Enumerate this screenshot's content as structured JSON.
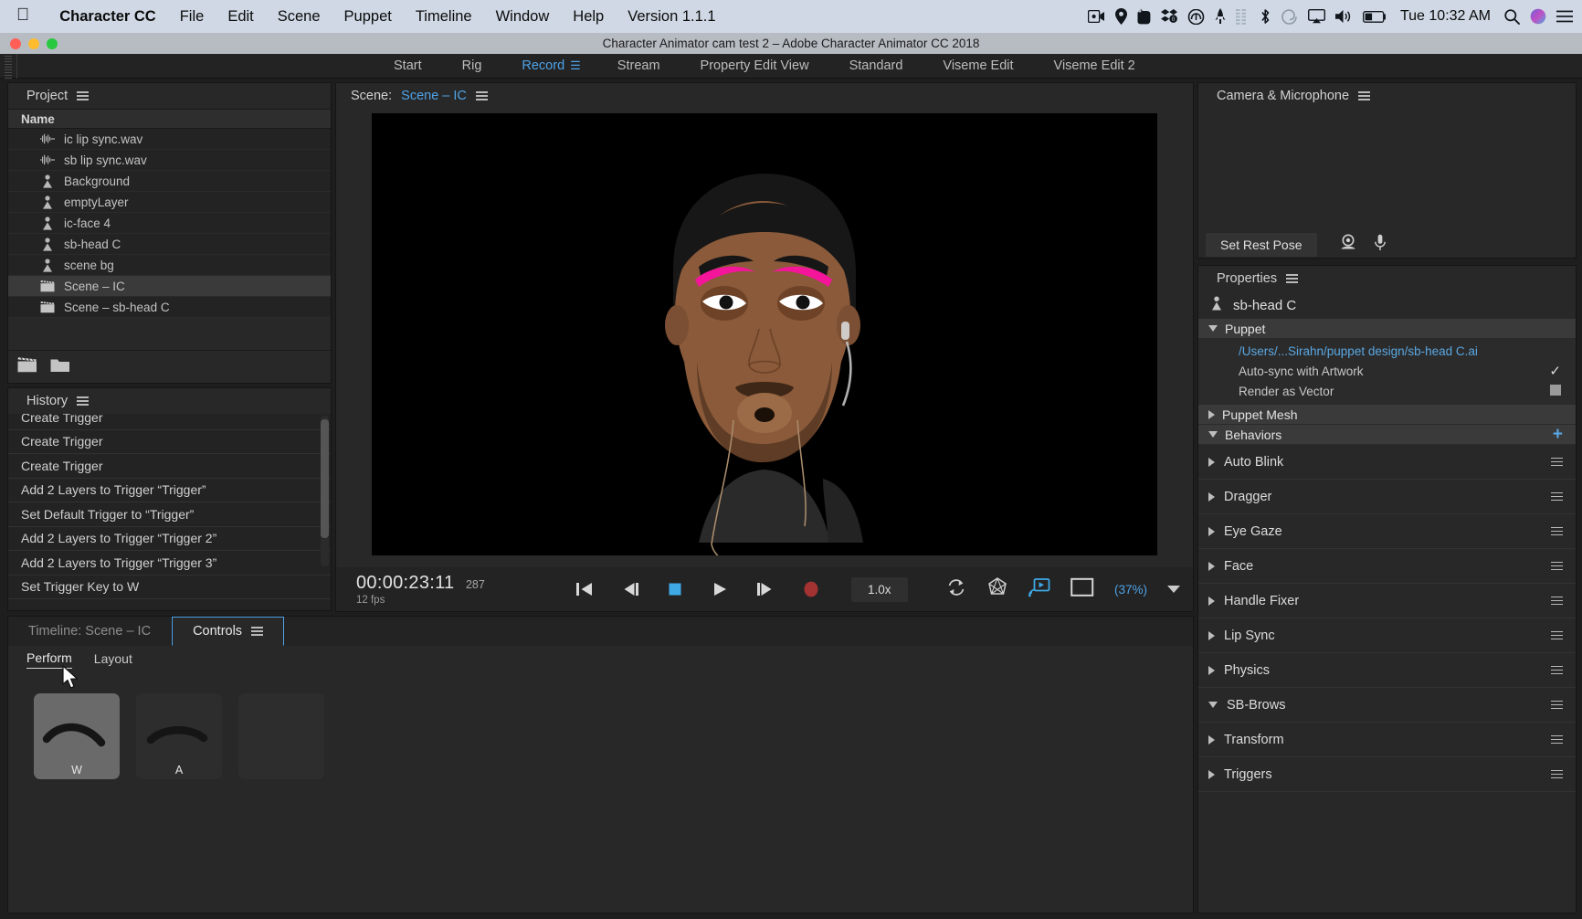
{
  "macbar": {
    "apple": "apple-logo",
    "items": [
      {
        "label": "Character CC",
        "bold": true
      },
      {
        "label": "File",
        "bold": false
      },
      {
        "label": "Edit",
        "bold": false
      },
      {
        "label": "Scene",
        "bold": false
      },
      {
        "label": "Puppet",
        "bold": false
      },
      {
        "label": "Timeline",
        "bold": false
      },
      {
        "label": "Window",
        "bold": false
      },
      {
        "label": "Help",
        "bold": false
      },
      {
        "label": "Version 1.1.1",
        "bold": false
      }
    ],
    "status_icons": [
      "screen-record-icon",
      "location-icon",
      "evernote-icon",
      "dropbox-icon",
      "creative-cloud-icon",
      "rocket-icon",
      "equalizer-icon",
      "bluetooth-icon",
      "spiral-icon",
      "airplay-icon",
      "volume-icon",
      "battery-icon"
    ],
    "clock": "Tue 10:32 AM",
    "search": "search-icon",
    "siri": "siri-icon",
    "notifications": "notification-center-icon"
  },
  "titlebar": {
    "title": "Character Animator cam test 2 – Adobe Character Animator CC 2018"
  },
  "workspaces": {
    "items": [
      {
        "label": "Start",
        "active": false
      },
      {
        "label": "Rig",
        "active": false
      },
      {
        "label": "Record",
        "active": true
      },
      {
        "label": "Stream",
        "active": false
      },
      {
        "label": "Property Edit View",
        "active": false
      },
      {
        "label": "Standard",
        "active": false
      },
      {
        "label": "Viseme Edit",
        "active": false
      },
      {
        "label": "Viseme Edit 2",
        "active": false
      }
    ],
    "menu_icon": "workspace-menu-icon"
  },
  "project": {
    "title": "Project",
    "menu_icon": "panel-menu-icon",
    "column_header": "Name",
    "items": [
      {
        "name": "ic lip sync.wav",
        "icon": "audio-waveform-icon",
        "selected": false
      },
      {
        "name": "sb lip sync.wav",
        "icon": "audio-waveform-icon",
        "selected": false
      },
      {
        "name": "Background",
        "icon": "puppet-icon",
        "selected": false
      },
      {
        "name": "emptyLayer",
        "icon": "puppet-icon",
        "selected": false
      },
      {
        "name": "ic-face 4",
        "icon": "puppet-icon",
        "selected": false
      },
      {
        "name": "sb-head C",
        "icon": "puppet-icon",
        "selected": false
      },
      {
        "name": "scene bg",
        "icon": "puppet-icon",
        "selected": false
      },
      {
        "name": "Scene – IC",
        "icon": "scene-clapper-icon",
        "selected": true
      },
      {
        "name": "Scene – sb-head C",
        "icon": "scene-clapper-icon",
        "selected": false
      }
    ],
    "footer_icons": [
      "new-scene-icon",
      "new-folder-icon"
    ]
  },
  "history": {
    "title": "History",
    "menu_icon": "panel-menu-icon",
    "items": [
      "Create Trigger",
      "Create Trigger",
      "Create Trigger",
      "Add 2 Layers to Trigger “Trigger”",
      "Set Default Trigger to “Trigger”",
      "Add 2 Layers to Trigger “Trigger 2”",
      "Add 2 Layers to Trigger “Trigger 3”",
      "Set Trigger Key to W"
    ]
  },
  "scene": {
    "label": "Scene:",
    "name": "Scene – IC",
    "menu_icon": "panel-menu-icon"
  },
  "transport": {
    "timecode": "00:00:23:11",
    "frame": "287",
    "fps": "12 fps",
    "buttons": [
      {
        "name": "go-to-start-button",
        "icon": "skip-to-start-icon"
      },
      {
        "name": "step-back-button",
        "icon": "step-backward-icon"
      },
      {
        "name": "stop-button",
        "icon": "stop-icon"
      },
      {
        "name": "play-button",
        "icon": "play-icon"
      },
      {
        "name": "step-forward-button",
        "icon": "step-forward-icon"
      },
      {
        "name": "record-button",
        "icon": "record-icon"
      }
    ],
    "speed": "1.0x",
    "right_icons": [
      "loop-icon",
      "mesh-icon",
      "stream-cast-icon"
    ],
    "fit_icon": "fit-frame-icon",
    "zoom": "(37%)",
    "zoom_caret": "chevron-down-icon"
  },
  "camera": {
    "title": "Camera & Microphone",
    "menu_icon": "panel-menu-icon",
    "set_rest_pose": "Set Rest Pose",
    "icons": [
      "camera-icon",
      "microphone-icon"
    ]
  },
  "properties": {
    "title": "Properties",
    "menu_icon": "panel-menu-icon",
    "object_name": "sb-head C",
    "object_icon": "puppet-icon",
    "groups": [
      {
        "label": "Puppet",
        "expanded": true,
        "rows": [
          {
            "label": "/Users/...Sirahn/puppet design/sb-head C.ai",
            "type": "link",
            "value": ""
          },
          {
            "label": "Auto-sync with Artwork",
            "type": "checkbox",
            "value": "checked"
          },
          {
            "label": "Render as Vector",
            "type": "checkbox",
            "value": "unchecked"
          }
        ]
      }
    ],
    "puppet_mesh": {
      "label": "Puppet Mesh",
      "expanded": false
    },
    "behaviors_header": {
      "label": "Behaviors",
      "expanded": true,
      "add_icon": "plus-icon"
    },
    "behaviors": [
      {
        "label": "Auto Blink",
        "expanded": false
      },
      {
        "label": "Dragger",
        "expanded": false
      },
      {
        "label": "Eye Gaze",
        "expanded": false
      },
      {
        "label": "Face",
        "expanded": false
      },
      {
        "label": "Handle Fixer",
        "expanded": false
      },
      {
        "label": "Lip Sync",
        "expanded": false
      },
      {
        "label": "Physics",
        "expanded": false
      },
      {
        "label": "SB-Brows",
        "expanded": true
      },
      {
        "label": "Transform",
        "expanded": false
      },
      {
        "label": "Triggers",
        "expanded": false
      }
    ]
  },
  "bottom": {
    "tabs": [
      {
        "label": "Timeline: Scene – IC",
        "active": false,
        "has_menu": false
      },
      {
        "label": "Controls",
        "active": true,
        "has_menu": true,
        "menu_icon": "panel-menu-icon"
      }
    ],
    "subtabs": [
      {
        "label": "Perform",
        "active": true
      },
      {
        "label": "Layout",
        "active": false
      }
    ],
    "triggers": [
      {
        "label": "W",
        "selected": true,
        "art": "eyebrow-raised"
      },
      {
        "label": "A",
        "selected": false,
        "art": "eyebrow-flat"
      },
      {
        "label": "",
        "selected": false,
        "art": "empty"
      }
    ]
  },
  "colors": {
    "accent": "#4ea3e8",
    "panel_bg": "#282828",
    "list_bg": "#232828",
    "record_red": "#a33232",
    "brow_pink": "#f5159b",
    "skin": "#8a5a3a"
  }
}
